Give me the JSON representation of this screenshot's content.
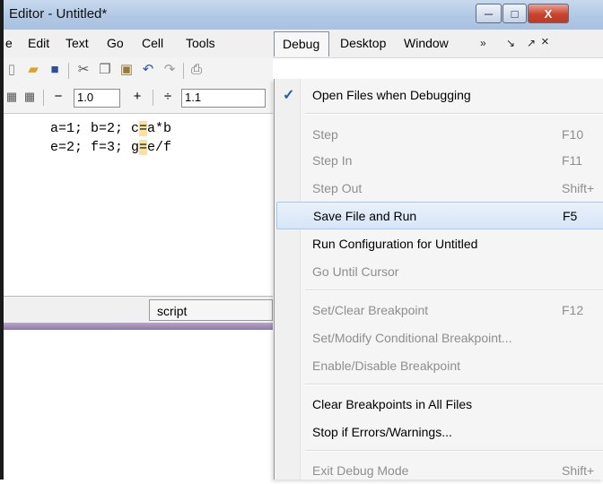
{
  "window": {
    "title": "Editor - Untitled*",
    "controls": {
      "minimize": "─",
      "maximize": "□",
      "close": "X"
    }
  },
  "menubar": {
    "items": [
      "e",
      "Edit",
      "Text",
      "Go",
      "Cell",
      "Tools",
      "Debug",
      "Desktop",
      "Window"
    ],
    "overflow": "»",
    "dock": "↘",
    "undock": "↗",
    "close": "×"
  },
  "toolbar": {
    "icons": [
      "new-file",
      "open-folder",
      "save",
      "cut",
      "copy",
      "paste",
      "undo",
      "redo",
      "print"
    ],
    "cell_minus": "−",
    "cell_value1": "1.0",
    "cell_plus": "+",
    "cell_divide": "÷",
    "cell_value2": "1.1"
  },
  "editor": {
    "lines": [
      {
        "pre": "a=1; b=2; c",
        "hl": "=",
        "post": "a*b"
      },
      {
        "pre": "e=2; f=3; g",
        "hl": "=",
        "post": "e/f"
      }
    ]
  },
  "status": {
    "mode": "script"
  },
  "debug_menu": {
    "items": [
      {
        "label": "Open Files when Debugging",
        "key": "",
        "enabled": true,
        "checked": true
      },
      {
        "label": "Step",
        "key": "F10",
        "enabled": false
      },
      {
        "label": "Step In",
        "key": "F11",
        "enabled": false
      },
      {
        "label": "Step Out",
        "key": "Shift+",
        "enabled": false
      },
      {
        "label": "Save File and Run",
        "key": "F5",
        "enabled": true,
        "selected": true
      },
      {
        "label": "Run Configuration for Untitled",
        "key": "",
        "enabled": true
      },
      {
        "label": "Go Until Cursor",
        "key": "",
        "enabled": false
      },
      {
        "label": "Set/Clear Breakpoint",
        "key": "F12",
        "enabled": false
      },
      {
        "label": "Set/Modify Conditional Breakpoint...",
        "key": "",
        "enabled": false
      },
      {
        "label": "Enable/Disable Breakpoint",
        "key": "",
        "enabled": false
      },
      {
        "label": "Clear Breakpoints in All Files",
        "key": "",
        "enabled": true
      },
      {
        "label": "Stop if Errors/Warnings...",
        "key": "",
        "enabled": true
      },
      {
        "label": "Exit Debug Mode",
        "key": "Shift+",
        "enabled": false
      }
    ]
  },
  "colors": {
    "accent": "#2a5ea8",
    "highlight": "#f9e0a3",
    "disabled_text": "#8e8e8e"
  }
}
